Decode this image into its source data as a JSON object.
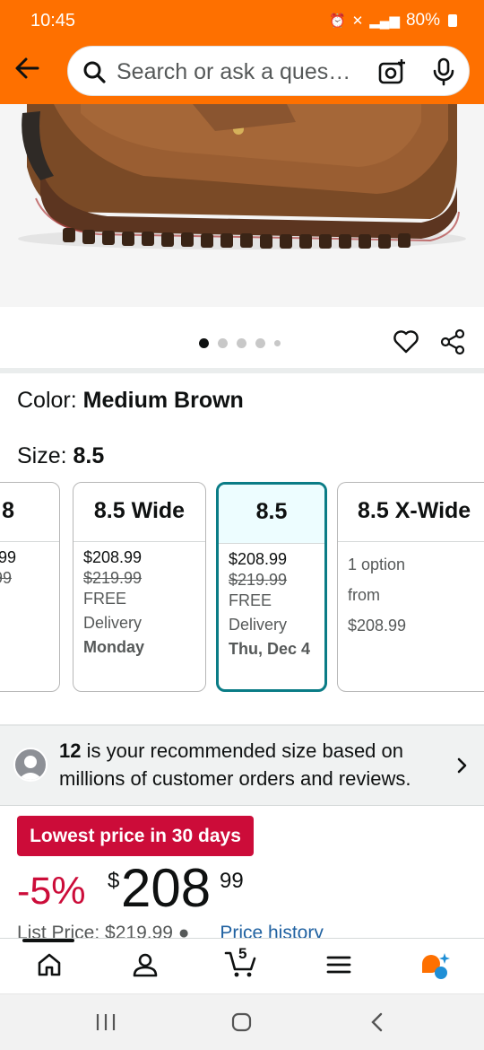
{
  "status": {
    "time": "10:45",
    "battery": "80%"
  },
  "search": {
    "placeholder": "Search or ask a ques…"
  },
  "gallery": {
    "total_images": 5,
    "active_index": 0
  },
  "product": {
    "color_label": "Color: ",
    "color_value": "Medium Brown",
    "size_label": "Size: ",
    "size_value": "8.5"
  },
  "size_cards": [
    {
      "title": "8",
      "price": ".99",
      "list_price": "99",
      "selected": false
    },
    {
      "title": "8.5 Wide",
      "price": "$208.99",
      "list_price": "$219.99",
      "free": "FREE",
      "delivery": "Delivery",
      "day": "Monday",
      "selected": false
    },
    {
      "title": "8.5",
      "price": "$208.99",
      "list_price": "$219.99",
      "free": "FREE",
      "delivery": "Delivery",
      "day": "Thu, Dec 4",
      "selected": true
    },
    {
      "title": "8.5 X-Wide",
      "options": "1 option",
      "from": "from",
      "price": "$208.99",
      "selected": false
    }
  ],
  "recommendation": {
    "size": "12",
    "text": " is your recommended size based on millions of customer orders and reviews."
  },
  "deal": {
    "badge": "Lowest price in 30 days",
    "discount": "-5%",
    "currency": "$",
    "price_whole": "208",
    "price_fraction": "99",
    "list_price_text": "List Price: $219.99",
    "price_history": "Price history"
  },
  "bottom_nav": {
    "cart_count": "5",
    "items": [
      "home-icon",
      "account-icon",
      "cart-icon",
      "menu-icon",
      "rufus-ai-icon"
    ]
  },
  "colors": {
    "header": "#fe7000",
    "deal_red": "#cc0c39",
    "selected_border": "#0a7c86",
    "link_blue": "#2162a1"
  }
}
